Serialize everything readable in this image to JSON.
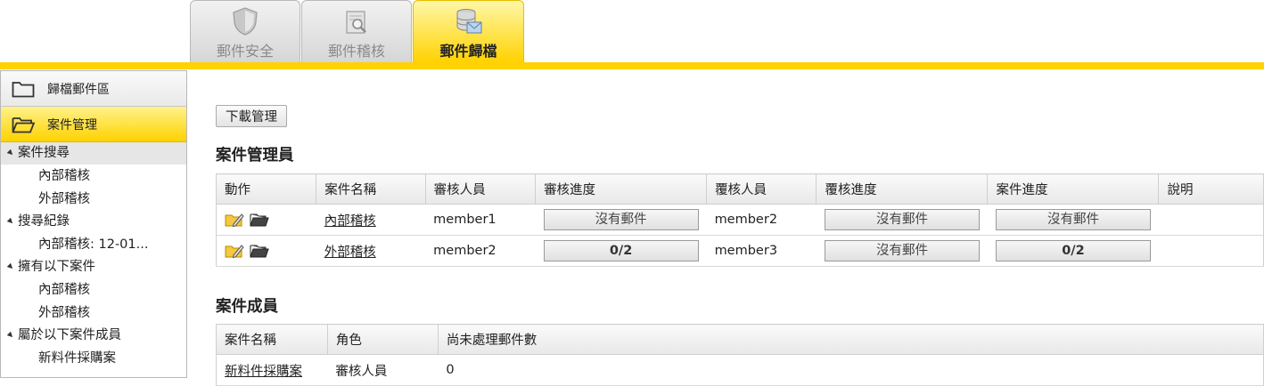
{
  "tabs": [
    {
      "label": "郵件安全",
      "icon": "shield-icon"
    },
    {
      "label": "郵件稽核",
      "icon": "mail-search-icon"
    },
    {
      "label": "郵件歸檔",
      "icon": "archive-database-icon",
      "active": true
    }
  ],
  "sidebar": {
    "nav": [
      {
        "label": "歸檔郵件區",
        "icon": "folder-icon"
      },
      {
        "label": "案件管理",
        "icon": "folder-open-icon",
        "active": true
      }
    ],
    "tree": [
      {
        "label": "案件搜尋",
        "items": [
          "內部稽核",
          "外部稽核"
        ]
      },
      {
        "label": "搜尋紀錄",
        "items": [
          "內部稽核: 12-01..."
        ]
      },
      {
        "label": "擁有以下案件",
        "items": [
          "內部稽核",
          "外部稽核"
        ]
      },
      {
        "label": "屬於以下案件成員",
        "items": [
          "新料件採購案"
        ]
      }
    ]
  },
  "main": {
    "download_button": "下載管理",
    "managers": {
      "title": "案件管理員",
      "columns": [
        "動作",
        "案件名稱",
        "審核人員",
        "審核進度",
        "覆核人員",
        "覆核進度",
        "案件進度",
        "說明"
      ],
      "rows": [
        {
          "name": "內部稽核",
          "reviewer": "member1",
          "review_progress": "沒有郵件",
          "rechecker": "member2",
          "recheck_progress": "沒有郵件",
          "case_progress": "沒有郵件",
          "note": ""
        },
        {
          "name": "外部稽核",
          "reviewer": "member2",
          "review_progress": "0/2",
          "rechecker": "member3",
          "recheck_progress": "沒有郵件",
          "case_progress": "0/2",
          "note": ""
        }
      ]
    },
    "members": {
      "title": "案件成員",
      "columns": [
        "案件名稱",
        "角色",
        "尚未處理郵件數"
      ],
      "rows": [
        {
          "name": "新料件採購案",
          "role": "審核人員",
          "pending": "0"
        }
      ]
    }
  },
  "colors": {
    "accent": "#ffd200",
    "tab_inactive": "#d6d6d6"
  }
}
